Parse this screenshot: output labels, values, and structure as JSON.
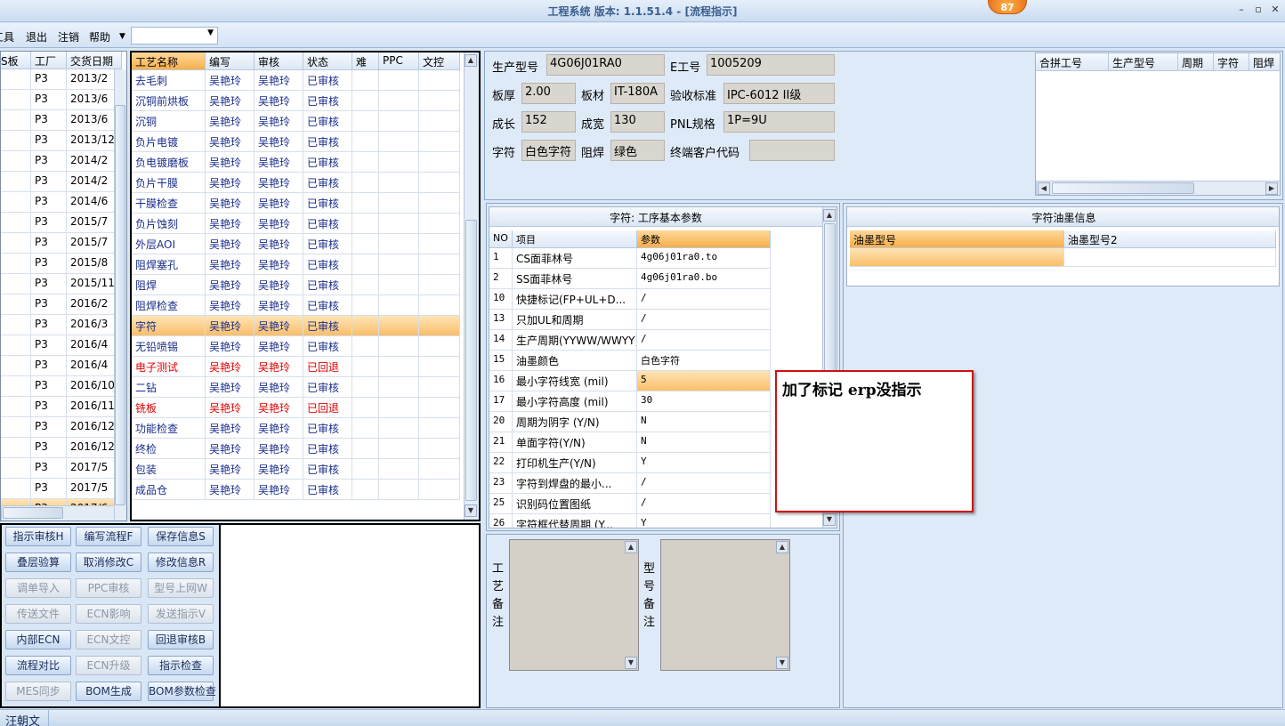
{
  "window": {
    "title": "工程系统  版本: 1.1.51.4 - [流程指示]",
    "badge": "87"
  },
  "menu": [
    "工具",
    "退出",
    "注销",
    "帮助"
  ],
  "left_grid": {
    "headers": [
      "S板",
      "工厂",
      "交货日期"
    ],
    "rows": [
      [
        "P3",
        "2013/2"
      ],
      [
        "P3",
        "2013/6"
      ],
      [
        "P3",
        "2013/6"
      ],
      [
        "P3",
        "2013/12"
      ],
      [
        "P3",
        "2014/2"
      ],
      [
        "P3",
        "2014/2"
      ],
      [
        "P3",
        "2014/6"
      ],
      [
        "P3",
        "2015/7"
      ],
      [
        "P3",
        "2015/7"
      ],
      [
        "P3",
        "2015/8"
      ],
      [
        "P3",
        "2015/11"
      ],
      [
        "P3",
        "2016/2"
      ],
      [
        "P3",
        "2016/3"
      ],
      [
        "P3",
        "2016/4"
      ],
      [
        "P3",
        "2016/4"
      ],
      [
        "P3",
        "2016/10"
      ],
      [
        "P3",
        "2016/11"
      ],
      [
        "P3",
        "2016/12"
      ],
      [
        "P3",
        "2016/12"
      ],
      [
        "P3",
        "2017/5"
      ],
      [
        "P3",
        "2017/5"
      ],
      [
        "P3",
        "2017/6"
      ]
    ]
  },
  "process_grid": {
    "headers": [
      "工艺名称",
      "编写",
      "审核",
      "状态",
      "难",
      "PPC",
      "文控"
    ],
    "rows": [
      {
        "name": "去毛刺",
        "writer": "吴艳玲",
        "reviewer": "吴艳玲",
        "status": "已审核",
        "red": false
      },
      {
        "name": "沉铜前烘板",
        "writer": "吴艳玲",
        "reviewer": "吴艳玲",
        "status": "已审核",
        "red": false
      },
      {
        "name": "沉铜",
        "writer": "吴艳玲",
        "reviewer": "吴艳玲",
        "status": "已审核",
        "red": false
      },
      {
        "name": "负片电镀",
        "writer": "吴艳玲",
        "reviewer": "吴艳玲",
        "status": "已审核",
        "red": false
      },
      {
        "name": "负电镀磨板",
        "writer": "吴艳玲",
        "reviewer": "吴艳玲",
        "status": "已审核",
        "red": false
      },
      {
        "name": "负片干膜",
        "writer": "吴艳玲",
        "reviewer": "吴艳玲",
        "status": "已审核",
        "red": false
      },
      {
        "name": "干膜检查",
        "writer": "吴艳玲",
        "reviewer": "吴艳玲",
        "status": "已审核",
        "red": false
      },
      {
        "name": "负片蚀刻",
        "writer": "吴艳玲",
        "reviewer": "吴艳玲",
        "status": "已审核",
        "red": false
      },
      {
        "name": "外层AOI",
        "writer": "吴艳玲",
        "reviewer": "吴艳玲",
        "status": "已审核",
        "red": false
      },
      {
        "name": "阻焊塞孔",
        "writer": "吴艳玲",
        "reviewer": "吴艳玲",
        "status": "已审核",
        "red": false
      },
      {
        "name": "阻焊",
        "writer": "吴艳玲",
        "reviewer": "吴艳玲",
        "status": "已审核",
        "red": false
      },
      {
        "name": "阻焊检查",
        "writer": "吴艳玲",
        "reviewer": "吴艳玲",
        "status": "已审核",
        "red": false
      },
      {
        "name": "字符",
        "writer": "吴艳玲",
        "reviewer": "吴艳玲",
        "status": "已审核",
        "red": false,
        "selected": true
      },
      {
        "name": "无铅喷锡",
        "writer": "吴艳玲",
        "reviewer": "吴艳玲",
        "status": "已审核",
        "red": false
      },
      {
        "name": "电子测试",
        "writer": "吴艳玲",
        "reviewer": "吴艳玲",
        "status": "已回退",
        "red": true
      },
      {
        "name": "二钻",
        "writer": "吴艳玲",
        "reviewer": "吴艳玲",
        "status": "已审核",
        "red": false
      },
      {
        "name": "铣板",
        "writer": "吴艳玲",
        "reviewer": "吴艳玲",
        "status": "已回退",
        "red": true
      },
      {
        "name": "功能检查",
        "writer": "吴艳玲",
        "reviewer": "吴艳玲",
        "status": "已审核",
        "red": false
      },
      {
        "name": "终检",
        "writer": "吴艳玲",
        "reviewer": "吴艳玲",
        "status": "已审核",
        "red": false
      },
      {
        "name": "包装",
        "writer": "吴艳玲",
        "reviewer": "吴艳玲",
        "status": "已审核",
        "red": false
      },
      {
        "name": "成品仓",
        "writer": "吴艳玲",
        "reviewer": "吴艳玲",
        "status": "已审核",
        "red": false
      }
    ]
  },
  "buttons": [
    [
      "指示审核H",
      "编写流程F",
      "保存信息S"
    ],
    [
      "叠层验算",
      "取消修改C",
      "修改信息R"
    ],
    [
      "调单导入",
      "PPC审核",
      "型号上网W"
    ],
    [
      "传送文件",
      "ECN影响",
      "发送指示V"
    ],
    [
      "内部ECN",
      "ECN文控",
      "回退审核B"
    ],
    [
      "流程对比",
      "ECN升级",
      "指示检查"
    ],
    [
      "MES同步",
      "BOM生成",
      "BOM参数检查"
    ]
  ],
  "button_disabled": [
    [
      false,
      false,
      false
    ],
    [
      false,
      false,
      false
    ],
    [
      true,
      true,
      true
    ],
    [
      true,
      true,
      true
    ],
    [
      false,
      true,
      false
    ],
    [
      false,
      true,
      false
    ],
    [
      true,
      false,
      false
    ]
  ],
  "info": {
    "part_no_label": "生产型号",
    "part_no": "4G06J01RA0",
    "e_no_label": "E工号",
    "e_no": "1005209",
    "thickness_label": "板厚",
    "thickness": "2.00",
    "material_label": "板材",
    "material": "IT-180A",
    "standard_label": "验收标准",
    "standard": "IPC-6012 II级",
    "length_label": "成长",
    "length": "152",
    "width_label": "成宽",
    "width": "130",
    "pnl_label": "PNL规格",
    "pnl": "1P=9U",
    "char_label": "字符",
    "char": "白色字符",
    "mask_label": "阻焊",
    "mask": "绿色",
    "customer_label": "终端客户代码",
    "customer": ""
  },
  "merge_grid": {
    "headers": [
      "合拼工号",
      "生产型号",
      "周期",
      "字符",
      "阻焊"
    ]
  },
  "params": {
    "title": "字符: 工序基本参数",
    "headers": [
      "NO",
      "项目",
      "参数"
    ],
    "rows": [
      [
        "1",
        "CS面菲林号",
        "4g06j01ra0.to"
      ],
      [
        "2",
        "SS面菲林号",
        "4g06j01ra0.bo"
      ],
      [
        "10",
        "快捷标记(FP+UL+D...",
        "/"
      ],
      [
        "13",
        "只加UL和周期",
        "/"
      ],
      [
        "14",
        "生产周期(YYWW/WWYY)",
        "/"
      ],
      [
        "15",
        "油墨颜色",
        "白色字符"
      ],
      [
        "16",
        "最小字符线宽 (mil)",
        "5"
      ],
      [
        "17",
        "最小字符高度 (mil)",
        "30"
      ],
      [
        "20",
        "周期为阴字 (Y/N)",
        "N"
      ],
      [
        "21",
        "单面字符(Y/N)",
        "N"
      ],
      [
        "22",
        "打印机生产(Y/N)",
        "Y"
      ],
      [
        "23",
        "字符到焊盘的最小...",
        "/"
      ],
      [
        "25",
        "识别码位置图纸",
        "/"
      ],
      [
        "26",
        "字符框代替周期 (Y...",
        "Y"
      ]
    ]
  },
  "ink": {
    "title": "字符油墨信息",
    "headers": [
      "油墨型号",
      "油墨型号2"
    ]
  },
  "notes": {
    "process_label": "工艺备注",
    "model_label": "型号备注"
  },
  "callout": "加了标记  erp没指示",
  "status": {
    "user": "汪朝文"
  }
}
